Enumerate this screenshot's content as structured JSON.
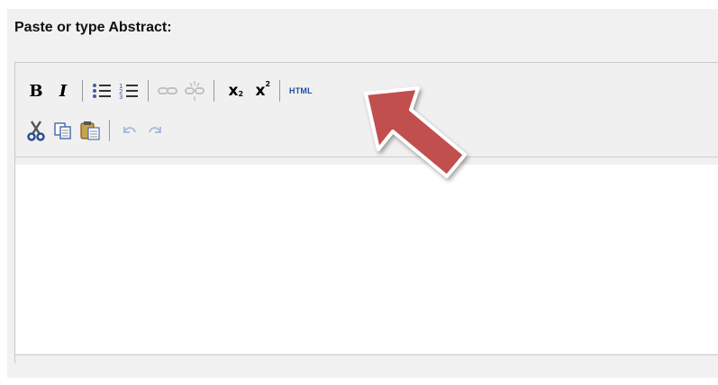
{
  "field": {
    "label": "Paste or type Abstract:"
  },
  "editor": {
    "content": "",
    "toolbar": {
      "row1": [
        {
          "name": "bold-button",
          "icon": "bold-icon",
          "label": "B"
        },
        {
          "name": "italic-button",
          "icon": "italic-icon",
          "label": "I"
        },
        {
          "name": "bulleted-list-button",
          "icon": "bulleted-list-icon"
        },
        {
          "name": "numbered-list-button",
          "icon": "numbered-list-icon"
        },
        {
          "name": "insert-link-button",
          "icon": "link-icon",
          "enabled": false
        },
        {
          "name": "remove-link-button",
          "icon": "unlink-icon",
          "enabled": false
        },
        {
          "name": "subscript-button",
          "icon": "subscript-icon"
        },
        {
          "name": "superscript-button",
          "icon": "superscript-icon"
        },
        {
          "name": "html-source-button",
          "icon": "html-icon",
          "label": "HTML"
        }
      ],
      "row2": [
        {
          "name": "cut-button",
          "icon": "scissors-icon"
        },
        {
          "name": "copy-button",
          "icon": "copy-icon"
        },
        {
          "name": "paste-button",
          "icon": "clipboard-icon"
        },
        {
          "name": "undo-button",
          "icon": "undo-icon",
          "enabled": false
        },
        {
          "name": "redo-button",
          "icon": "redo-icon",
          "enabled": false
        }
      ]
    }
  },
  "annotation": {
    "type": "arrow",
    "target": "html-source-button",
    "color": "#c0504d"
  },
  "colors": {
    "panel_bg": "#f1f1f1",
    "editor_bg": "#ffffff",
    "link_blue": "#2050a0"
  }
}
